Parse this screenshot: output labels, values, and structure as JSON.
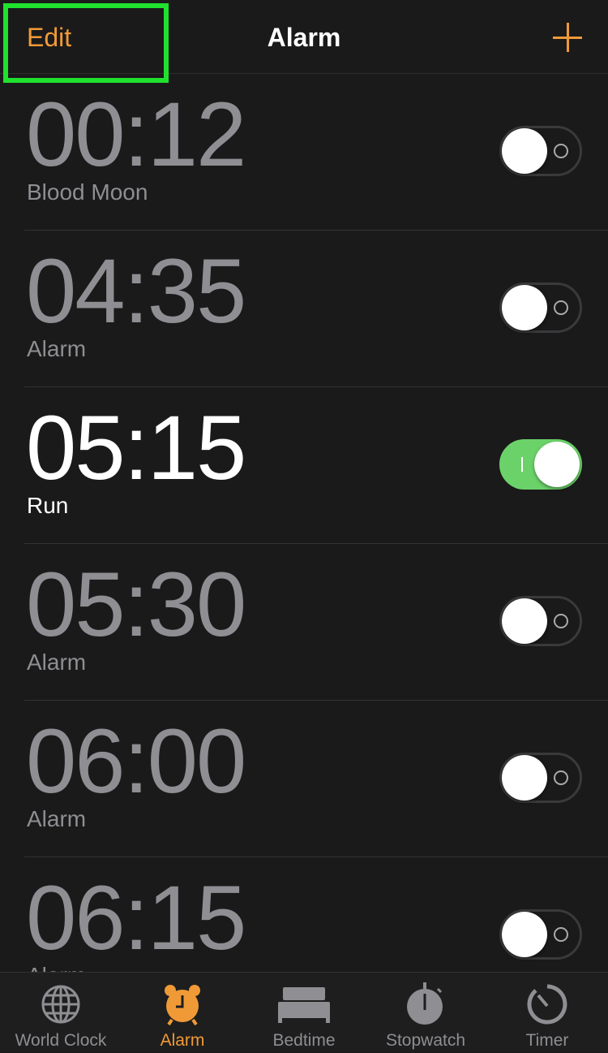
{
  "header": {
    "edit_label": "Edit",
    "title": "Alarm",
    "add_icon": "plus-icon"
  },
  "colors": {
    "accent": "#f09a37",
    "toggle_on": "#6bd26a",
    "highlight": "#1fe12e"
  },
  "alarms": [
    {
      "time": "00:12",
      "label": "Blood Moon",
      "enabled": false
    },
    {
      "time": "04:35",
      "label": "Alarm",
      "enabled": false
    },
    {
      "time": "05:15",
      "label": "Run",
      "enabled": true
    },
    {
      "time": "05:30",
      "label": "Alarm",
      "enabled": false
    },
    {
      "time": "06:00",
      "label": "Alarm",
      "enabled": false
    },
    {
      "time": "06:15",
      "label": "Alarm",
      "enabled": false
    }
  ],
  "tabs": [
    {
      "label": "World Clock",
      "icon": "globe-icon"
    },
    {
      "label": "Alarm",
      "icon": "alarm-clock-icon",
      "active": true
    },
    {
      "label": "Bedtime",
      "icon": "bed-icon"
    },
    {
      "label": "Stopwatch",
      "icon": "stopwatch-icon"
    },
    {
      "label": "Timer",
      "icon": "timer-icon"
    }
  ]
}
